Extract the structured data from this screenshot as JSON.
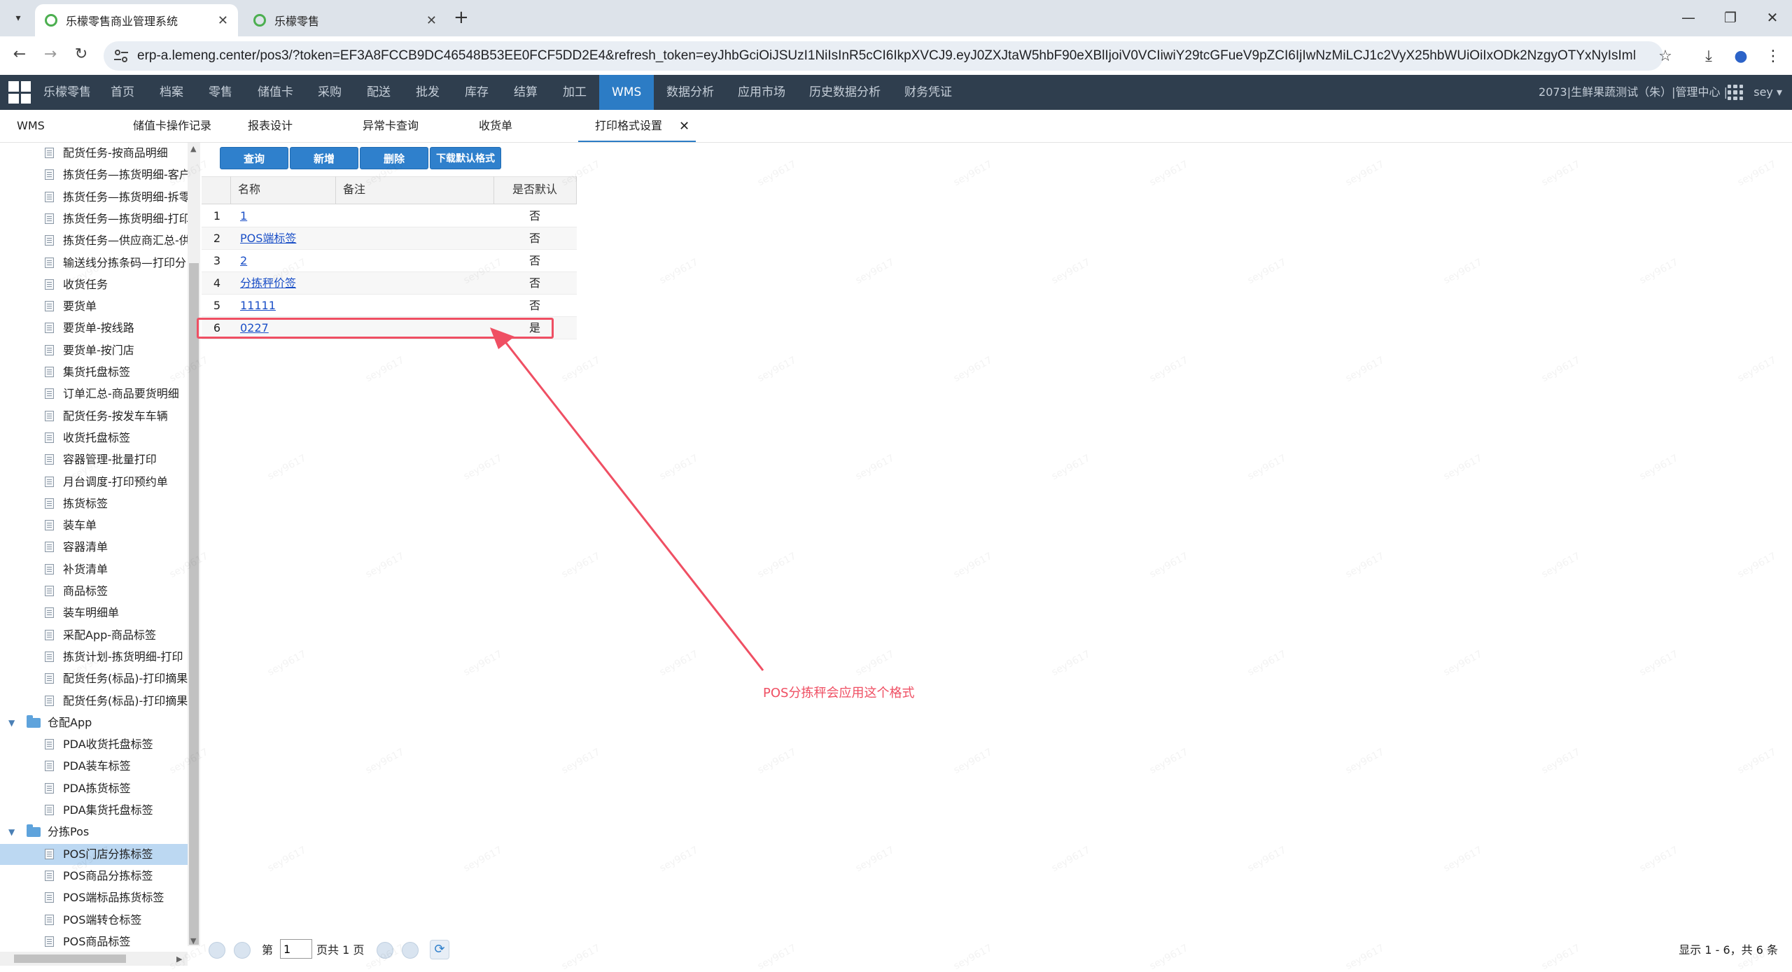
{
  "browser": {
    "tabs": [
      {
        "title": "乐檬零售商业管理系统",
        "active": true
      },
      {
        "title": "乐檬零售",
        "active": false
      }
    ],
    "new_tab": "+",
    "window_controls": {
      "minimize": "—",
      "restore": "❐",
      "close": "✕"
    },
    "url": "erp-a.lemeng.center/pos3/?token=EF3A8FCCB9DC46548B53EE0FCF5DD2E4&refresh_token=eyJhbGciOiJSUzI1NiIsInR5cCI6IkpXVCJ9.eyJ0ZXJtaW5hbF90eXBlIjoiV0VCIiwiY29tcGFueV9pZCI6IjIwNzMiLCJ1c2VyX25hbWUiOiIxODk2NzgyOTYxNyIsImNvbXBhbnlf...",
    "icons": [
      "back-icon",
      "forward-icon",
      "reload-icon",
      "site-settings-icon",
      "star-icon",
      "download-icon",
      "profile-icon",
      "menu-icon"
    ]
  },
  "appnav": {
    "items": [
      "乐檬零售",
      "首页",
      "档案",
      "零售",
      "储值卡",
      "采购",
      "配送",
      "批发",
      "库存",
      "结算",
      "加工",
      "WMS",
      "数据分析",
      "应用市场",
      "历史数据分析",
      "财务凭证"
    ],
    "active": "WMS",
    "right_text": "2073|生鲜果蔬测试（朱）|管理中心 |",
    "user": "sey ▾"
  },
  "content_tabs": {
    "module_label": "WMS",
    "items": [
      "储值卡操作记录",
      "报表设计",
      "异常卡查询",
      "收货单",
      "打印格式设置"
    ],
    "active": "打印格式设置",
    "close_glyph": "✕"
  },
  "sidebar": {
    "rows": [
      {
        "type": "leaf",
        "label": "配货任务-按商品明细"
      },
      {
        "type": "leaf",
        "label": "拣货任务—拣货明细-客户"
      },
      {
        "type": "leaf",
        "label": "拣货任务—拣货明细-拆零"
      },
      {
        "type": "leaf",
        "label": "拣货任务—拣货明细-打印"
      },
      {
        "type": "leaf",
        "label": "拣货任务—供应商汇总-供"
      },
      {
        "type": "leaf",
        "label": "输送线分拣条码—打印分"
      },
      {
        "type": "leaf",
        "label": "收货任务"
      },
      {
        "type": "leaf",
        "label": "要货单"
      },
      {
        "type": "leaf",
        "label": "要货单-按线路"
      },
      {
        "type": "leaf",
        "label": "要货单-按门店"
      },
      {
        "type": "leaf",
        "label": "集货托盘标签"
      },
      {
        "type": "leaf",
        "label": "订单汇总-商品要货明细"
      },
      {
        "type": "leaf",
        "label": "配货任务-按发车车辆"
      },
      {
        "type": "leaf",
        "label": "收货托盘标签"
      },
      {
        "type": "leaf",
        "label": "容器管理-批量打印"
      },
      {
        "type": "leaf",
        "label": "月台调度-打印预约单"
      },
      {
        "type": "leaf",
        "label": "拣货标签"
      },
      {
        "type": "leaf",
        "label": "装车单"
      },
      {
        "type": "leaf",
        "label": "容器清单"
      },
      {
        "type": "leaf",
        "label": "补货清单"
      },
      {
        "type": "leaf",
        "label": "商品标签"
      },
      {
        "type": "leaf",
        "label": "装车明细单"
      },
      {
        "type": "leaf",
        "label": "采配App-商品标签"
      },
      {
        "type": "leaf",
        "label": "拣货计划-拣货明细-打印"
      },
      {
        "type": "leaf",
        "label": "配货任务(标品)-打印摘果"
      },
      {
        "type": "leaf",
        "label": "配货任务(标品)-打印摘果"
      },
      {
        "type": "folder",
        "label": "仓配App"
      },
      {
        "type": "leaf",
        "label": "PDA收货托盘标签"
      },
      {
        "type": "leaf",
        "label": "PDA装车标签"
      },
      {
        "type": "leaf",
        "label": "PDA拣货标签"
      },
      {
        "type": "leaf",
        "label": "PDA集货托盘标签"
      },
      {
        "type": "folder",
        "label": "分拣Pos"
      },
      {
        "type": "leaf",
        "label": "POS门店分拣标签",
        "selected": true
      },
      {
        "type": "leaf",
        "label": "POS商品分拣标签"
      },
      {
        "type": "leaf",
        "label": "POS端标品拣货标签"
      },
      {
        "type": "leaf",
        "label": "POS端转仓标签"
      },
      {
        "type": "leaf",
        "label": "POS商品标签"
      }
    ]
  },
  "toolbar": {
    "query": "查询",
    "add": "新增",
    "delete": "删除",
    "download_default": "下载默认格式"
  },
  "grid": {
    "columns": [
      "名称",
      "备注",
      "是否默认"
    ],
    "rows": [
      {
        "no": "1",
        "name": "1",
        "remark": "",
        "default": "否"
      },
      {
        "no": "2",
        "name": "POS端标签",
        "remark": "",
        "default": "否"
      },
      {
        "no": "3",
        "name": "2",
        "remark": "",
        "default": "否"
      },
      {
        "no": "4",
        "name": "分拣秤价签",
        "remark": "",
        "default": "否"
      },
      {
        "no": "5",
        "name": "11111",
        "remark": "",
        "default": "否"
      },
      {
        "no": "6",
        "name": "0227",
        "remark": "",
        "default": "是"
      }
    ]
  },
  "annotation": {
    "text": "POS分拣秤会应用这个格式",
    "color": "#ef4f63"
  },
  "pager": {
    "page_prefix": "第",
    "page_value": "1",
    "page_suffix": "页共 1 页",
    "summary": "显示 1 - 6，共 6 条",
    "refresh_glyph": "⟳"
  },
  "watermark": "sey9617",
  "colors": {
    "nav_bg": "#2f3e4e",
    "accent": "#2c7cc5",
    "button": "#2f80cc",
    "link": "#1a4fc7",
    "annotation": "#ef4f63",
    "selected_row": "#bcd8f2"
  }
}
